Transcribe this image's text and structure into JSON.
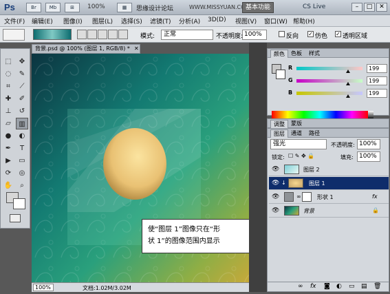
{
  "app": {
    "logo": "Ps",
    "icons": [
      "Br",
      "Mb"
    ],
    "zoom": "100%",
    "watermark_left": "思缘设计论坛",
    "watermark_right": "WWW.MISSYUAN.COM",
    "workspace_button": "基本功能",
    "cs_live": "CS Live",
    "window_controls": [
      "–",
      "□",
      "✕"
    ]
  },
  "menu": [
    "文件(F)",
    "编辑(E)",
    "图像(I)",
    "图层(L)",
    "选择(S)",
    "滤镜(T)",
    "分析(A)",
    "3D(D)",
    "视图(V)",
    "窗口(W)",
    "帮助(H)"
  ],
  "options": {
    "mode_label": "模式:",
    "mode_value": "正常",
    "opacity_label": "不透明度:",
    "opacity_value": "100%",
    "reverse_label": "反向",
    "dither_label": "仿色",
    "transparency_label": "透明区域"
  },
  "document": {
    "tab_title": "背景.psd @ 100% (图层 1, RGB/8) *",
    "close": "✕",
    "zoom": "100%",
    "info": "文档:1.02M/3.02M"
  },
  "callout": {
    "line1": "使“图层 1”图像只在“形",
    "line2": "状 1”的图像范围内显示"
  },
  "color_panel": {
    "tabs": [
      "颜色",
      "色板",
      "样式"
    ],
    "r": {
      "label": "R",
      "value": "199",
      "fraction": 0.78
    },
    "g": {
      "label": "G",
      "value": "199",
      "fraction": 0.78
    },
    "b": {
      "label": "B",
      "value": "199",
      "fraction": 0.78
    }
  },
  "adjust_panel": {
    "tabs": [
      "调整",
      "蒙版"
    ]
  },
  "layers_panel": {
    "tabs": [
      "图层",
      "通道",
      "路径"
    ],
    "blend_mode": "强光",
    "opacity_label": "不透明度:",
    "opacity_value": "100%",
    "lock_label": "锁定:",
    "fill_label": "填充:",
    "fill_value": "100%",
    "layers": [
      {
        "name": "图层 2"
      },
      {
        "name": "图层 1"
      },
      {
        "name": "形状 1"
      },
      {
        "name": "背景"
      }
    ],
    "fx": "fx",
    "footer_icons": [
      "link-icon",
      "fx-icon",
      "mask-icon",
      "adjustment-icon",
      "folder-icon",
      "new-layer-icon",
      "trash-icon"
    ]
  },
  "colors": {
    "canvas_dark": "#0d4048",
    "canvas_mid": "#1f8f7a",
    "canvas_yellow": "#b9b23b",
    "egg": "#f2d48a",
    "selected_layer": "#0f2d6b"
  }
}
